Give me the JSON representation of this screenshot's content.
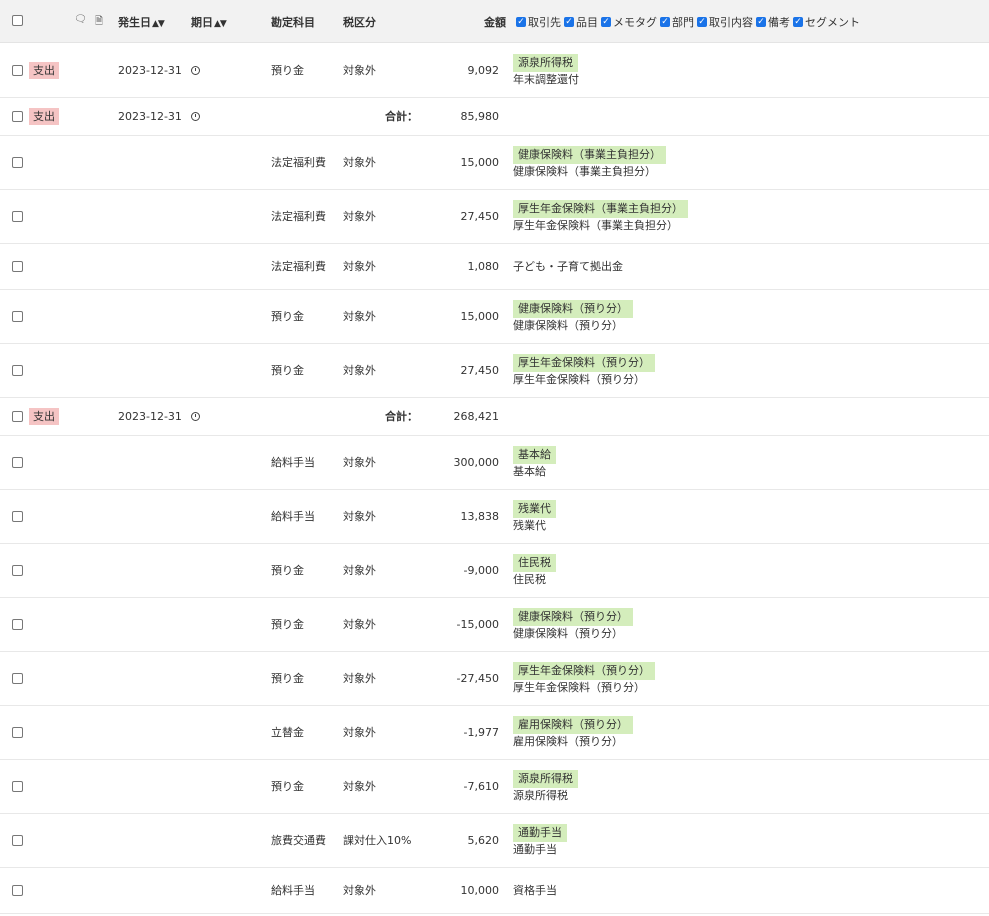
{
  "header": {
    "occurrence_date": "発生日",
    "due_date": "期日",
    "account": "勘定科目",
    "tax": "税区分",
    "amount": "金額",
    "toggles": [
      "取引先",
      "品目",
      "メモタグ",
      "部門",
      "取引内容",
      "備考",
      "セグメント"
    ]
  },
  "total_label": "合計：",
  "rows": [
    {
      "badge": "支出",
      "date": "2023-12-31",
      "account": "預り金",
      "tax": "対象外",
      "amount": "9,092",
      "tag": "源泉所得税",
      "desc": "年末調整還付"
    },
    {
      "badge": "支出",
      "date": "2023-12-31",
      "amount": "85,980",
      "is_total": true
    },
    {
      "account": "法定福利費",
      "tax": "対象外",
      "amount": "15,000",
      "tag": "健康保険料（事業主負担分）",
      "desc": "健康保険料（事業主負担分）"
    },
    {
      "account": "法定福利費",
      "tax": "対象外",
      "amount": "27,450",
      "tag": "厚生年金保険料（事業主負担分）",
      "desc": "厚生年金保険料（事業主負担分）"
    },
    {
      "account": "法定福利費",
      "tax": "対象外",
      "amount": "1,080",
      "desc": "子ども・子育て拠出金"
    },
    {
      "account": "預り金",
      "tax": "対象外",
      "amount": "15,000",
      "tag": "健康保険料（預り分）",
      "desc": "健康保険料（預り分）"
    },
    {
      "account": "預り金",
      "tax": "対象外",
      "amount": "27,450",
      "tag": "厚生年金保険料（預り分）",
      "desc": "厚生年金保険料（預り分）"
    },
    {
      "badge": "支出",
      "date": "2023-12-31",
      "amount": "268,421",
      "is_total": true
    },
    {
      "account": "給料手当",
      "tax": "対象外",
      "amount": "300,000",
      "tag": "基本給",
      "desc": "基本給"
    },
    {
      "account": "給料手当",
      "tax": "対象外",
      "amount": "13,838",
      "tag": "残業代",
      "desc": "残業代"
    },
    {
      "account": "預り金",
      "tax": "対象外",
      "amount": "-9,000",
      "tag": "住民税",
      "desc": "住民税"
    },
    {
      "account": "預り金",
      "tax": "対象外",
      "amount": "-15,000",
      "tag": "健康保険料（預り分）",
      "desc": "健康保険料（預り分）"
    },
    {
      "account": "預り金",
      "tax": "対象外",
      "amount": "-27,450",
      "tag": "厚生年金保険料（預り分）",
      "desc": "厚生年金保険料（預り分）"
    },
    {
      "account": "立替金",
      "tax": "対象外",
      "amount": "-1,977",
      "tag": "雇用保険料（預り分）",
      "desc": "雇用保険料（預り分）"
    },
    {
      "account": "預り金",
      "tax": "対象外",
      "amount": "-7,610",
      "tag": "源泉所得税",
      "desc": "源泉所得税"
    },
    {
      "account": "旅費交通費",
      "tax": "課対仕入10%",
      "amount": "5,620",
      "tag": "通勤手当",
      "desc": "通勤手当"
    },
    {
      "account": "給料手当",
      "tax": "対象外",
      "amount": "10,000",
      "desc": "資格手当"
    }
  ]
}
